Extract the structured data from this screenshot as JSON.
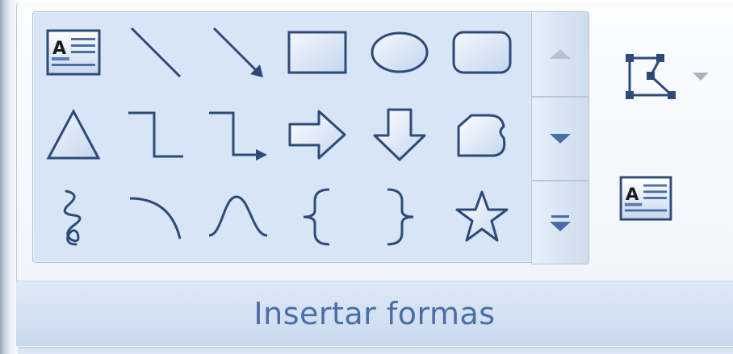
{
  "group": {
    "label": "Insertar formas"
  },
  "gallery": {
    "shapes": [
      {
        "name": "text-box-icon"
      },
      {
        "name": "line-icon"
      },
      {
        "name": "arrow-line-icon"
      },
      {
        "name": "rectangle-icon"
      },
      {
        "name": "oval-icon"
      },
      {
        "name": "rounded-rectangle-icon"
      },
      {
        "name": "triangle-icon"
      },
      {
        "name": "elbow-connector-icon"
      },
      {
        "name": "elbow-arrow-connector-icon"
      },
      {
        "name": "right-arrow-icon"
      },
      {
        "name": "down-arrow-icon"
      },
      {
        "name": "freeform-shape-icon"
      },
      {
        "name": "scribble-icon"
      },
      {
        "name": "arc-icon"
      },
      {
        "name": "curve-icon"
      },
      {
        "name": "left-brace-icon"
      },
      {
        "name": "right-brace-icon"
      },
      {
        "name": "star-icon"
      }
    ]
  },
  "colors": {
    "icon_stroke": "#2e4a78",
    "icon_fill": "#dde9f8",
    "label": "#4a6ea8",
    "gallery_bg": "#d8e5f6"
  },
  "icons": {
    "scroll_up": "chevron-up-icon",
    "scroll_down": "chevron-down-icon",
    "more": "more-icon",
    "edit_shape": "edit-shape-icon",
    "text_box": "text-box-icon"
  }
}
